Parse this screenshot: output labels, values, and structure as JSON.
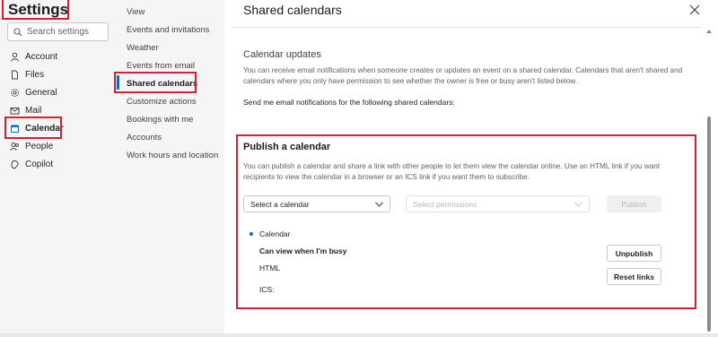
{
  "settings": {
    "title": "Settings",
    "search_placeholder": "Search settings"
  },
  "nav": {
    "items": [
      {
        "label": "Account",
        "icon": "person-icon"
      },
      {
        "label": "Files",
        "icon": "file-icon"
      },
      {
        "label": "General",
        "icon": "gear-icon"
      },
      {
        "label": "Mail",
        "icon": "mail-icon"
      },
      {
        "label": "Calendar",
        "icon": "calendar-icon",
        "selected": true
      },
      {
        "label": "People",
        "icon": "people-icon"
      },
      {
        "label": "Copilot",
        "icon": "copilot-icon"
      }
    ]
  },
  "subnav": {
    "items": [
      {
        "label": "View"
      },
      {
        "label": "Events and invitations"
      },
      {
        "label": "Weather"
      },
      {
        "label": "Events from email"
      },
      {
        "label": "Shared calendars",
        "selected": true
      },
      {
        "label": "Customize actions"
      },
      {
        "label": "Bookings with me"
      },
      {
        "label": "Accounts"
      },
      {
        "label": "Work hours and location"
      }
    ]
  },
  "main": {
    "title": "Shared calendars",
    "updates": {
      "heading": "Calendar updates",
      "description": "You can receive email notifications when someone creates or updates an event on a shared calendar. Calendars that aren't shared and calendars where you only have permission to see whether the owner is free or busy aren't listed below.",
      "prompt": "Send me email notifications for the following shared calendars:"
    },
    "publish": {
      "heading": "Publish a calendar",
      "description": "You can publish a calendar and share a link with other people to let them view the calendar online. Use an HTML link if you want recipients to view the calendar in a browser or an ICS link if you want them to subscribe.",
      "calendar_select_placeholder": "Select a calendar",
      "permissions_select_placeholder": "Select permissions",
      "publish_label": "Publish",
      "published": {
        "calendar_name": "Calendar",
        "permission": "Can view when I'm busy",
        "html_label": "HTML",
        "ics_label": "ICS:",
        "unpublish_label": "Unpublish",
        "reset_links_label": "Reset links"
      }
    }
  },
  "colors": {
    "accent": "#0f6cbd",
    "highlight_box": "#e01b2f"
  }
}
